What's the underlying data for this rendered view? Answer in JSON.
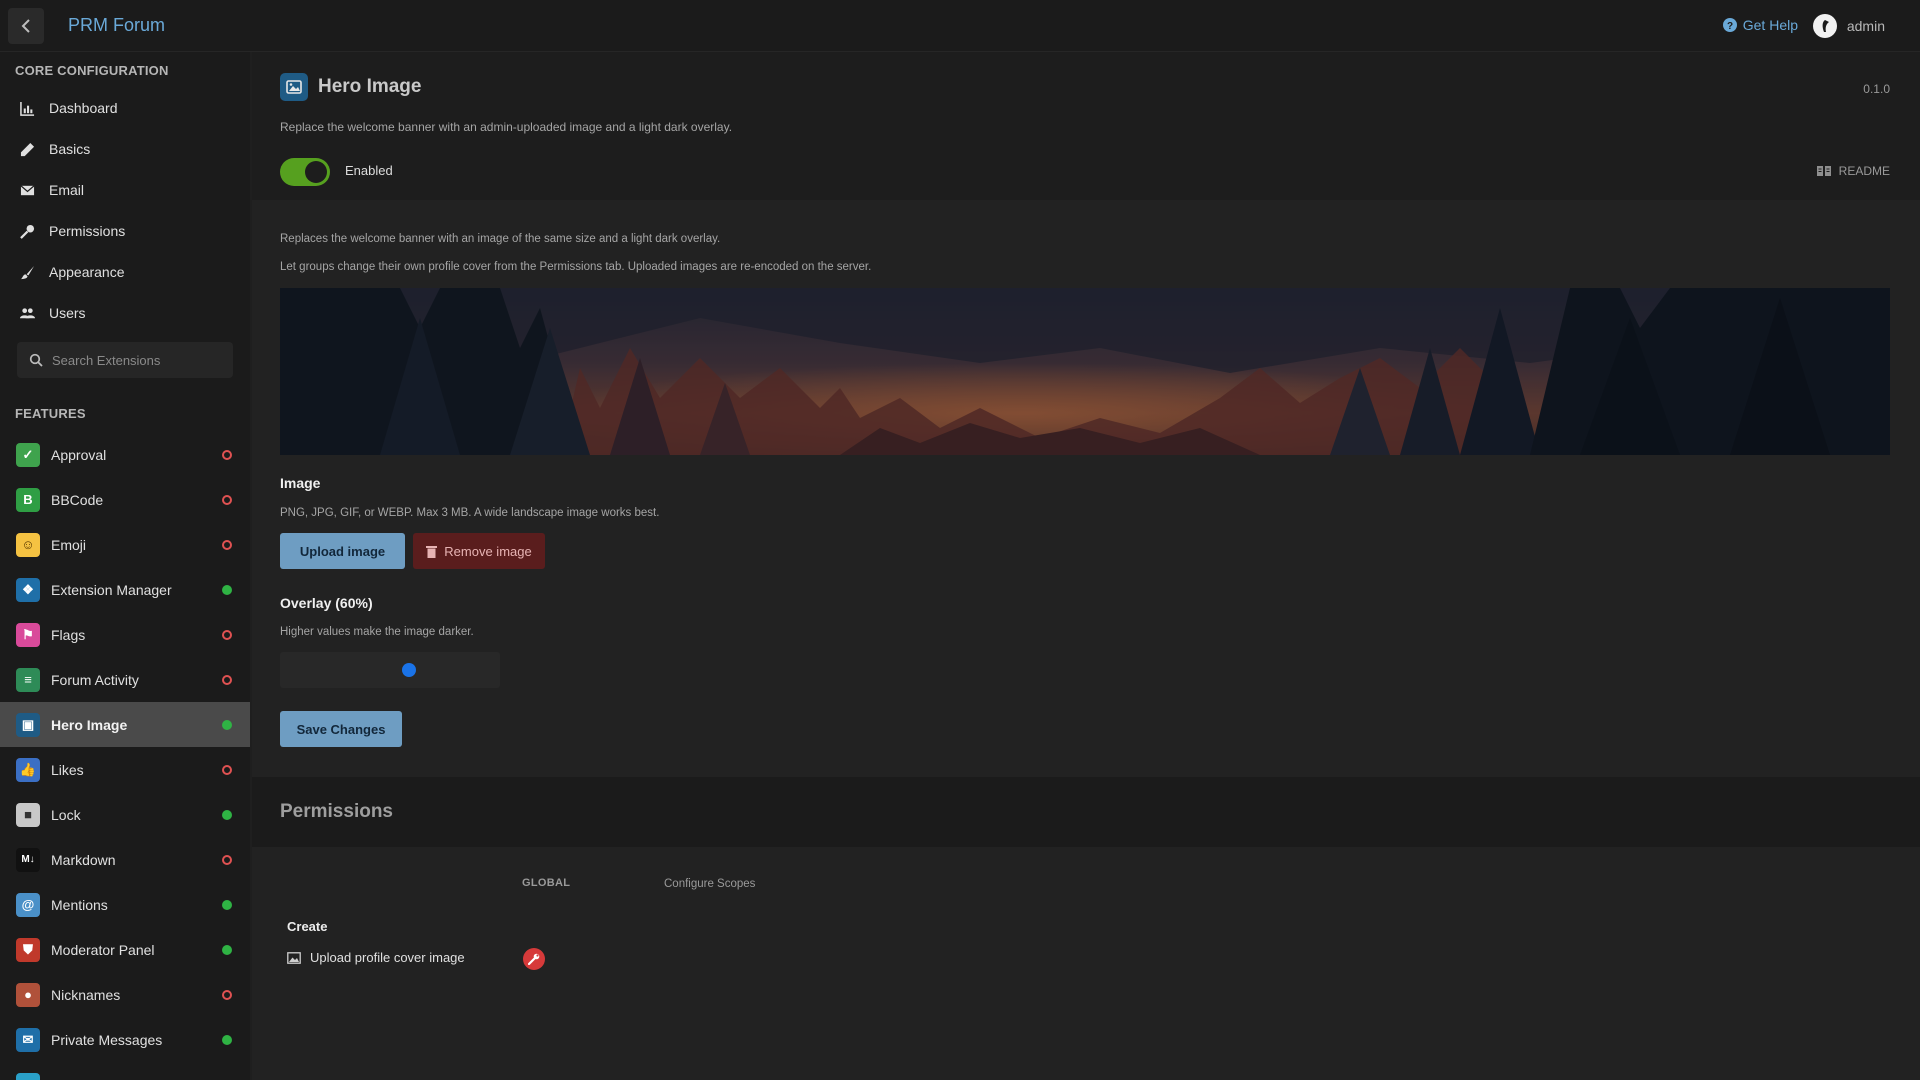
{
  "app": {
    "title": "PRM Forum"
  },
  "header": {
    "help_label": "Get Help",
    "user_name": "admin"
  },
  "sidebar": {
    "core_heading": "CORE CONFIGURATION",
    "core_items": [
      {
        "label": "Dashboard",
        "icon": "chart-icon"
      },
      {
        "label": "Basics",
        "icon": "pencil-icon"
      },
      {
        "label": "Email",
        "icon": "envelope-icon"
      },
      {
        "label": "Permissions",
        "icon": "key-icon"
      },
      {
        "label": "Appearance",
        "icon": "paintbrush-icon"
      },
      {
        "label": "Users",
        "icon": "users-icon"
      }
    ],
    "search_placeholder": "Search Extensions",
    "features_heading": "FEATURES",
    "extensions": [
      {
        "label": "Approval",
        "icon": "check-icon",
        "color": "#3fa34d",
        "enabled": false
      },
      {
        "label": "BBCode",
        "icon": "b-icon",
        "color": "#2f9e44",
        "enabled": false
      },
      {
        "label": "Emoji",
        "icon": "smile-icon",
        "color": "#f5c242",
        "enabled": false
      },
      {
        "label": "Extension Manager",
        "icon": "puzzle-icon",
        "color": "#1f6fa8",
        "enabled": true
      },
      {
        "label": "Flags",
        "icon": "flag-icon",
        "color": "#d94a9a",
        "enabled": false
      },
      {
        "label": "Forum Activity",
        "icon": "list-icon",
        "color": "#2e8b57",
        "enabled": false
      },
      {
        "label": "Hero Image",
        "icon": "image-icon",
        "color": "#1f5b85",
        "enabled": true,
        "active": true
      },
      {
        "label": "Likes",
        "icon": "thumbs-up-icon",
        "color": "#3b6fc4",
        "enabled": false
      },
      {
        "label": "Lock",
        "icon": "lock-icon",
        "color": "#c8c8c8",
        "enabled": true
      },
      {
        "label": "Markdown",
        "icon": "markdown-icon",
        "color": "#111111",
        "enabled": false
      },
      {
        "label": "Mentions",
        "icon": "at-icon",
        "color": "#4a90c8",
        "enabled": true
      },
      {
        "label": "Moderator Panel",
        "icon": "shield-icon",
        "color": "#c0392b",
        "enabled": true
      },
      {
        "label": "Nicknames",
        "icon": "user-icon",
        "color": "#b0513a",
        "enabled": false
      },
      {
        "label": "Private Messages",
        "icon": "envelope-icon",
        "color": "#1f6fa8",
        "enabled": true
      },
      {
        "label": "",
        "icon": "generic-icon",
        "color": "#2aa0c8",
        "enabled": false
      }
    ]
  },
  "extension": {
    "title": "Hero Image",
    "version": "0.1.0",
    "description": "Replace the welcome banner with an admin-uploaded image and a light dark overlay.",
    "toggle_label": "Enabled",
    "toggle_on": true,
    "readme_label": "README",
    "info_line_1": "Replaces the welcome banner with an image of the same size and a light dark overlay.",
    "info_line_2": "Let groups change their own profile cover from the Permissions tab. Uploaded images are re-encoded on the server."
  },
  "image_section": {
    "label": "Image",
    "help": "PNG, JPG, GIF, or WEBP. Max 3 MB. A wide landscape image works best.",
    "upload_label": "Upload image",
    "remove_label": "Remove image"
  },
  "overlay_section": {
    "label": "Overlay (60%)",
    "help": "Higher values make the image darker.",
    "value_percent": 60
  },
  "save_label": "Save Changes",
  "permissions": {
    "title": "Permissions",
    "col_global": "GLOBAL",
    "col_scopes": "Configure Scopes",
    "group_label": "Create",
    "row_label": "Upload profile cover image"
  }
}
